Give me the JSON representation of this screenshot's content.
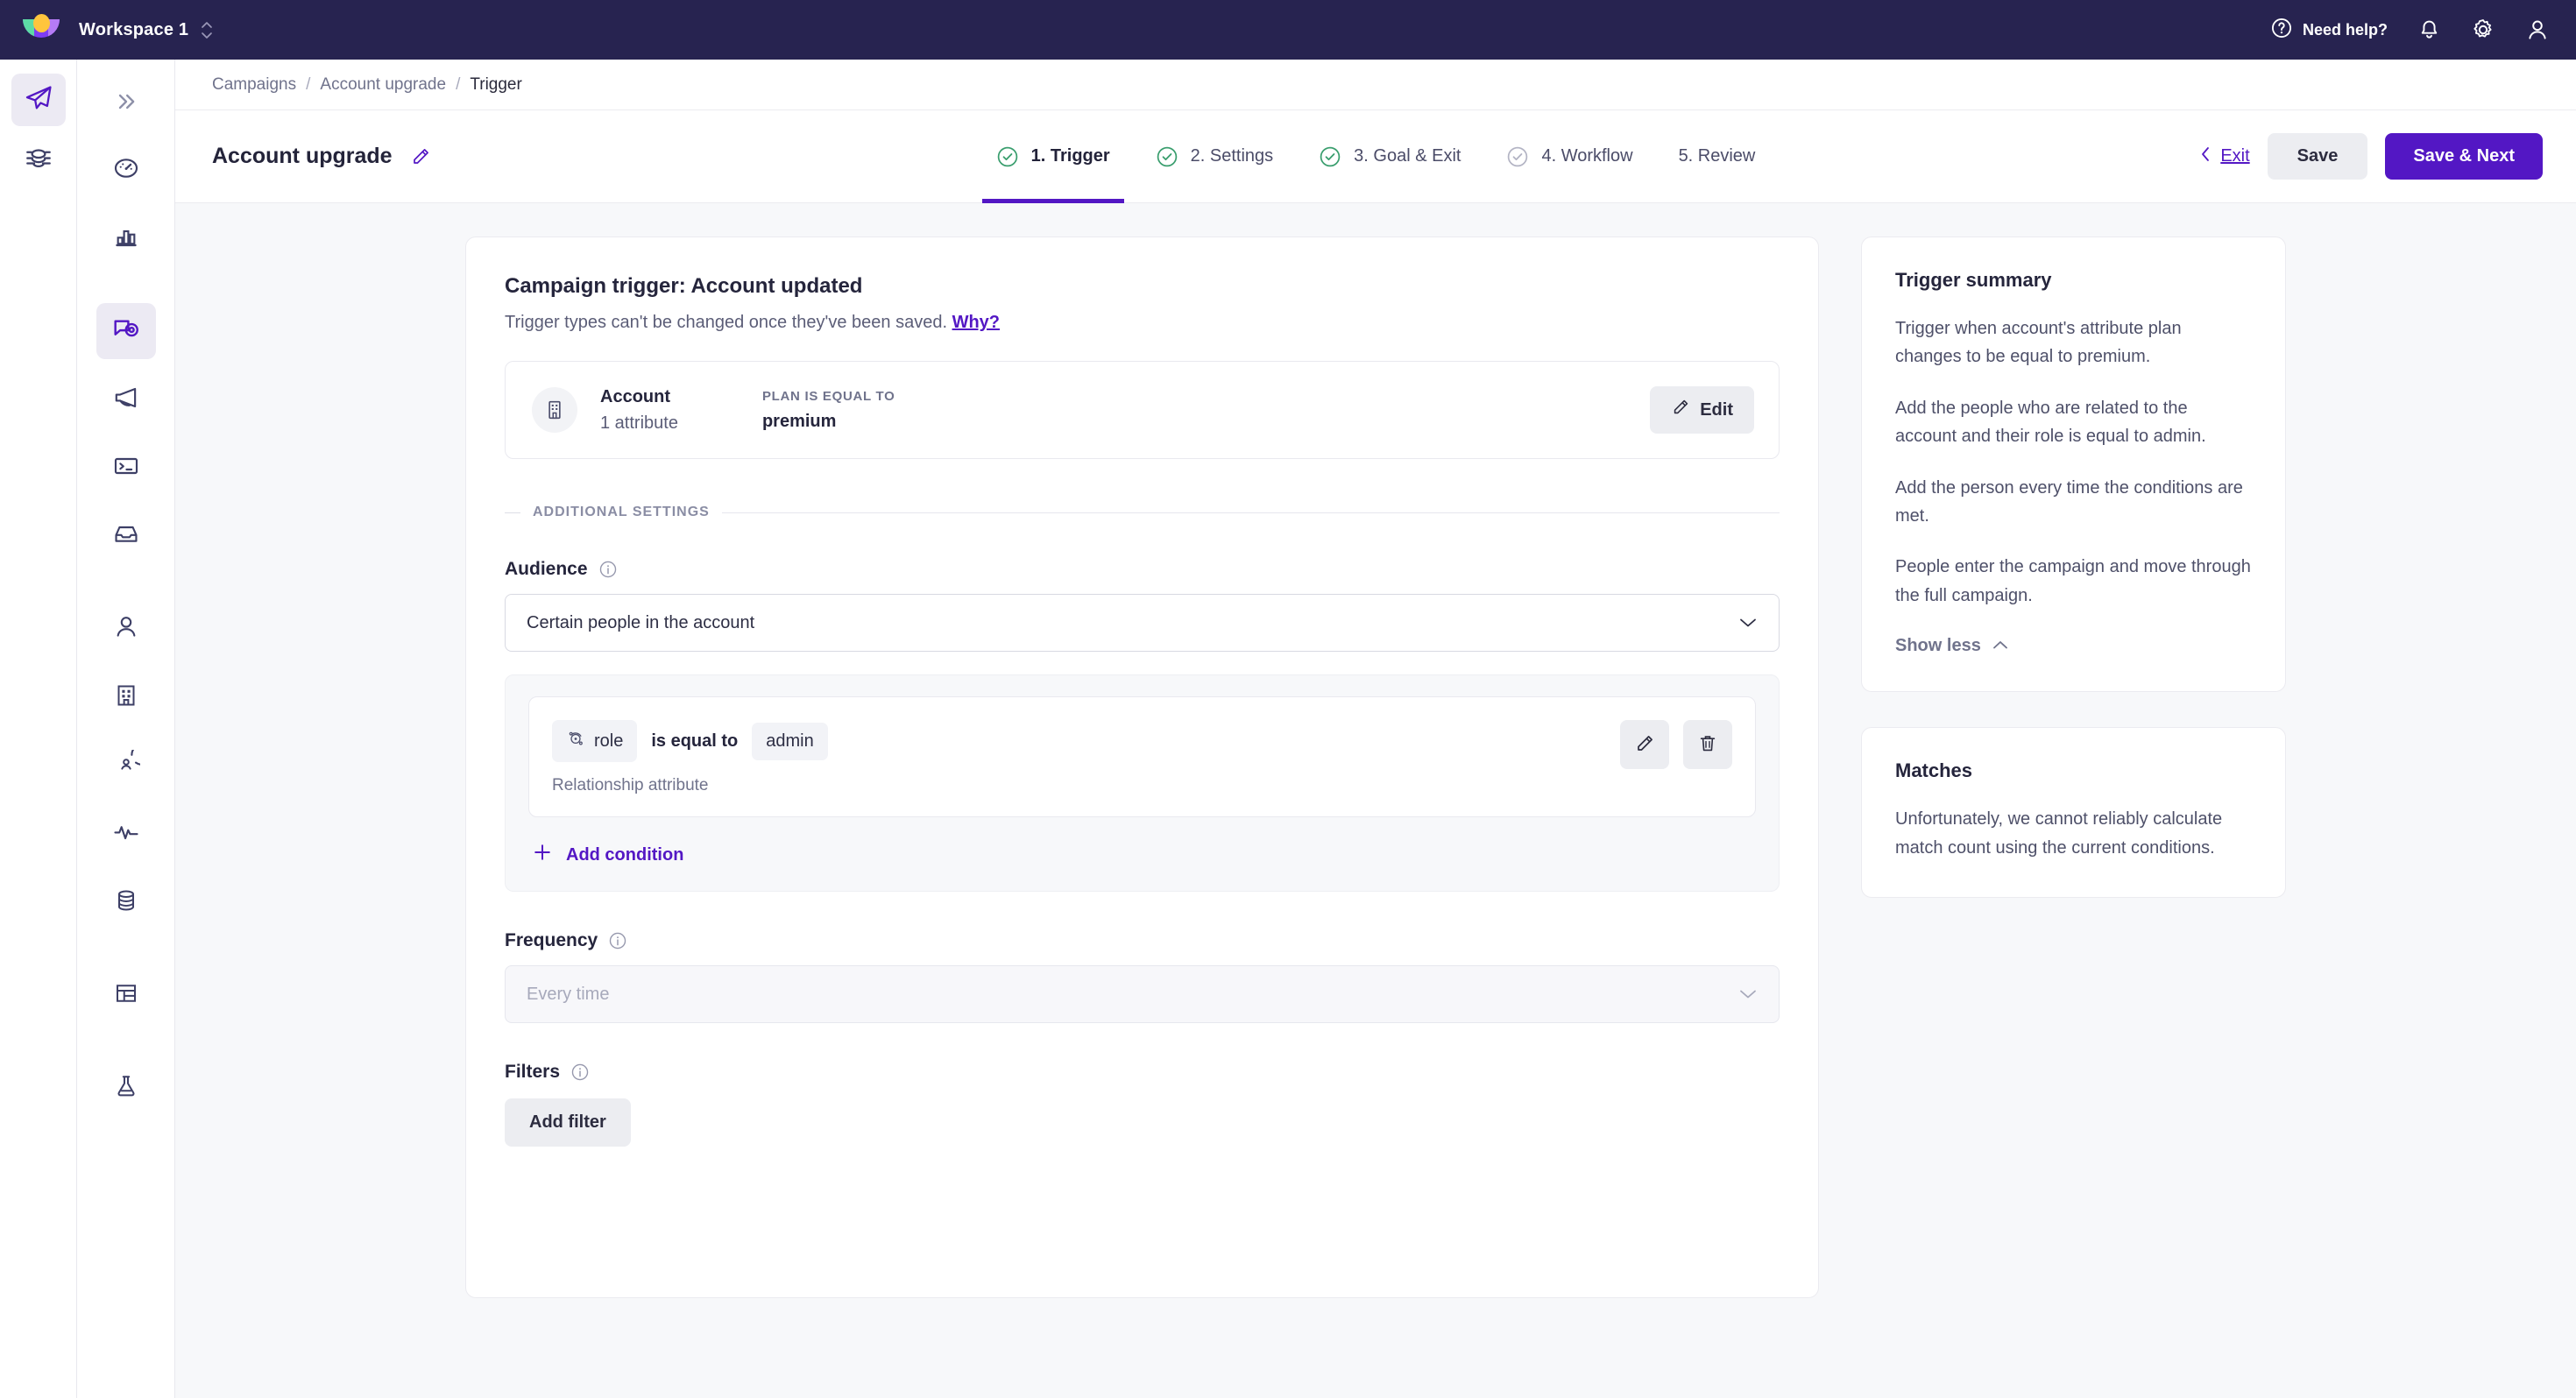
{
  "topbar": {
    "logo_name": "customer-io-logo",
    "workspace": "Workspace 1",
    "need_help": "Need help?",
    "icons": {
      "help": "question-circle-icon",
      "notifications": "bell-icon",
      "settings": "gear-icon",
      "account": "user-icon",
      "workspace_switch": "chevron-up-down-icon"
    },
    "colors": {
      "background": "#272350",
      "text": "#ffffff"
    }
  },
  "rail_primary": {
    "items": [
      {
        "name": "paper-plane-icon",
        "label": "Journeys",
        "active": true
      },
      {
        "name": "layers-icon",
        "label": "Data",
        "active": false
      }
    ]
  },
  "rail_secondary": {
    "collapse": {
      "name": "double-chevron-right-icon",
      "label": "Expand menu"
    },
    "items": [
      {
        "name": "gauge-icon",
        "label": "Dashboard",
        "active": false
      },
      {
        "name": "bar-chart-icon",
        "label": "Analytics",
        "active": false
      },
      {
        "name": "campaign-icon",
        "label": "Campaigns",
        "active": true
      },
      {
        "name": "megaphone-icon",
        "label": "Broadcasts",
        "active": false
      },
      {
        "name": "terminal-icon",
        "label": "Transactional",
        "active": false
      },
      {
        "name": "inbox-icon",
        "label": "Newsletters",
        "active": false
      },
      {
        "name": "person-icon",
        "label": "People",
        "active": false
      },
      {
        "name": "building-icon",
        "label": "Accounts",
        "active": false
      },
      {
        "name": "segment-icon",
        "label": "Segments",
        "active": false
      },
      {
        "name": "activity-icon",
        "label": "Activity",
        "active": false
      },
      {
        "name": "database-icon",
        "label": "Data index",
        "active": false
      },
      {
        "name": "table-icon",
        "label": "Collections",
        "active": false
      },
      {
        "name": "flask-icon",
        "label": "Experiments",
        "active": false
      }
    ]
  },
  "breadcrumb": {
    "items": [
      "Campaigns",
      "Account upgrade",
      "Trigger"
    ],
    "separator": "/"
  },
  "wizard": {
    "campaign_title": "Account upgrade",
    "edit_icon": "pencil-icon",
    "steps": [
      {
        "label": "1. Trigger",
        "state": "complete",
        "active": true
      },
      {
        "label": "2. Settings",
        "state": "complete",
        "active": false
      },
      {
        "label": "3. Goal & Exit",
        "state": "complete",
        "active": false
      },
      {
        "label": "4. Workflow",
        "state": "pending",
        "active": false
      },
      {
        "label": "5. Review",
        "state": "none",
        "active": false
      }
    ],
    "exit_label": "Exit",
    "exit_icon": "chevron-left-icon",
    "save_label": "Save",
    "save_next_label": "Save & Next",
    "accent": "#5317c4"
  },
  "main": {
    "title": "Campaign trigger: Account updated",
    "subtitle": "Trigger types can't be changed once they've been saved.",
    "why_link": "Why?",
    "trigger_row": {
      "icon": "building-icon",
      "object": "Account",
      "attribute_count": "1 attribute",
      "condition_label": "PLAN IS EQUAL TO",
      "condition_value": "premium",
      "edit_label": "Edit",
      "edit_icon": "pencil-icon"
    },
    "divider_label": "ADDITIONAL SETTINGS",
    "audience": {
      "label": "Audience",
      "info_icon": "info-icon",
      "value": "Certain people in the account",
      "caret_icon": "chevron-down-icon",
      "condition": {
        "attribute_icon": "relationship-icon",
        "attribute": "role",
        "operator": "is equal to",
        "value": "admin",
        "note": "Relationship attribute",
        "edit_icon": "pencil-icon",
        "delete_icon": "trash-icon"
      },
      "add_condition_label": "Add condition",
      "add_condition_icon": "plus-icon"
    },
    "frequency": {
      "label": "Frequency",
      "info_icon": "info-icon",
      "placeholder": "Every time",
      "value": "",
      "caret_icon": "chevron-down-icon"
    },
    "filters": {
      "label": "Filters",
      "info_icon": "info-icon",
      "add_filter_label": "Add filter"
    }
  },
  "sidebar_right": {
    "summary": {
      "title": "Trigger summary",
      "paragraphs": [
        "Trigger when account's attribute plan changes to be equal to premium.",
        "Add the people who are related to the account and their role is equal to admin.",
        "Add the person every time the conditions are met.",
        "People enter the campaign and move through the full campaign."
      ],
      "toggle_label": "Show less",
      "toggle_icon": "chevron-up-icon"
    },
    "matches": {
      "title": "Matches",
      "text": "Unfortunately, we cannot reliably calculate match count using the current conditions."
    }
  }
}
